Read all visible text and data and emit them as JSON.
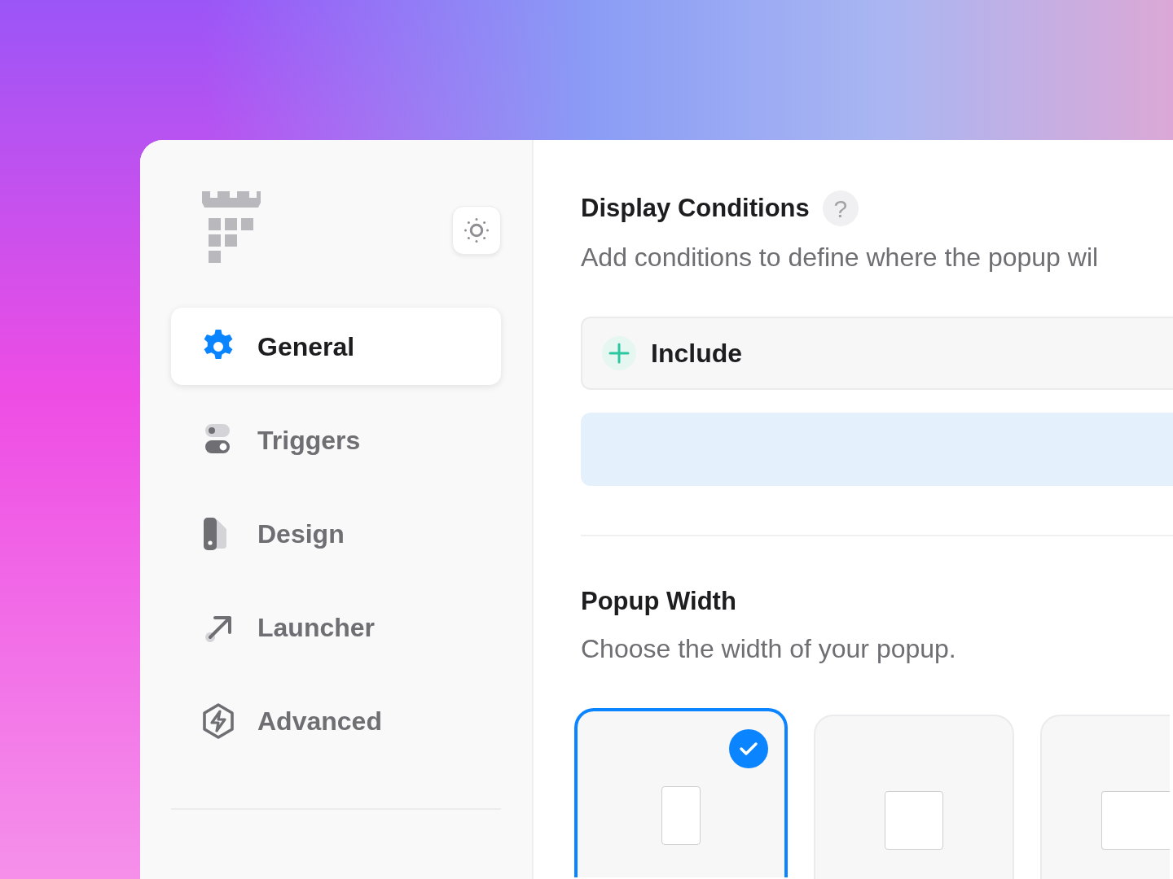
{
  "sidebar": {
    "items": [
      {
        "label": "General",
        "kind": "gear",
        "selected": true
      },
      {
        "label": "Triggers",
        "kind": "toggles",
        "selected": false
      },
      {
        "label": "Design",
        "kind": "swatch",
        "selected": false
      },
      {
        "label": "Launcher",
        "kind": "arrow",
        "selected": false
      },
      {
        "label": "Advanced",
        "kind": "bolt",
        "selected": false
      }
    ]
  },
  "display_conditions": {
    "title": "Display Conditions",
    "help": "?",
    "description": "Add conditions to define where the popup wil",
    "include_button": "Include"
  },
  "popup_width": {
    "title": "Popup Width",
    "description": "Choose the width of your popup.",
    "options": [
      {
        "kind": "narrow",
        "selected": true
      },
      {
        "kind": "medium",
        "selected": false
      },
      {
        "kind": "wide",
        "selected": false
      }
    ]
  }
}
